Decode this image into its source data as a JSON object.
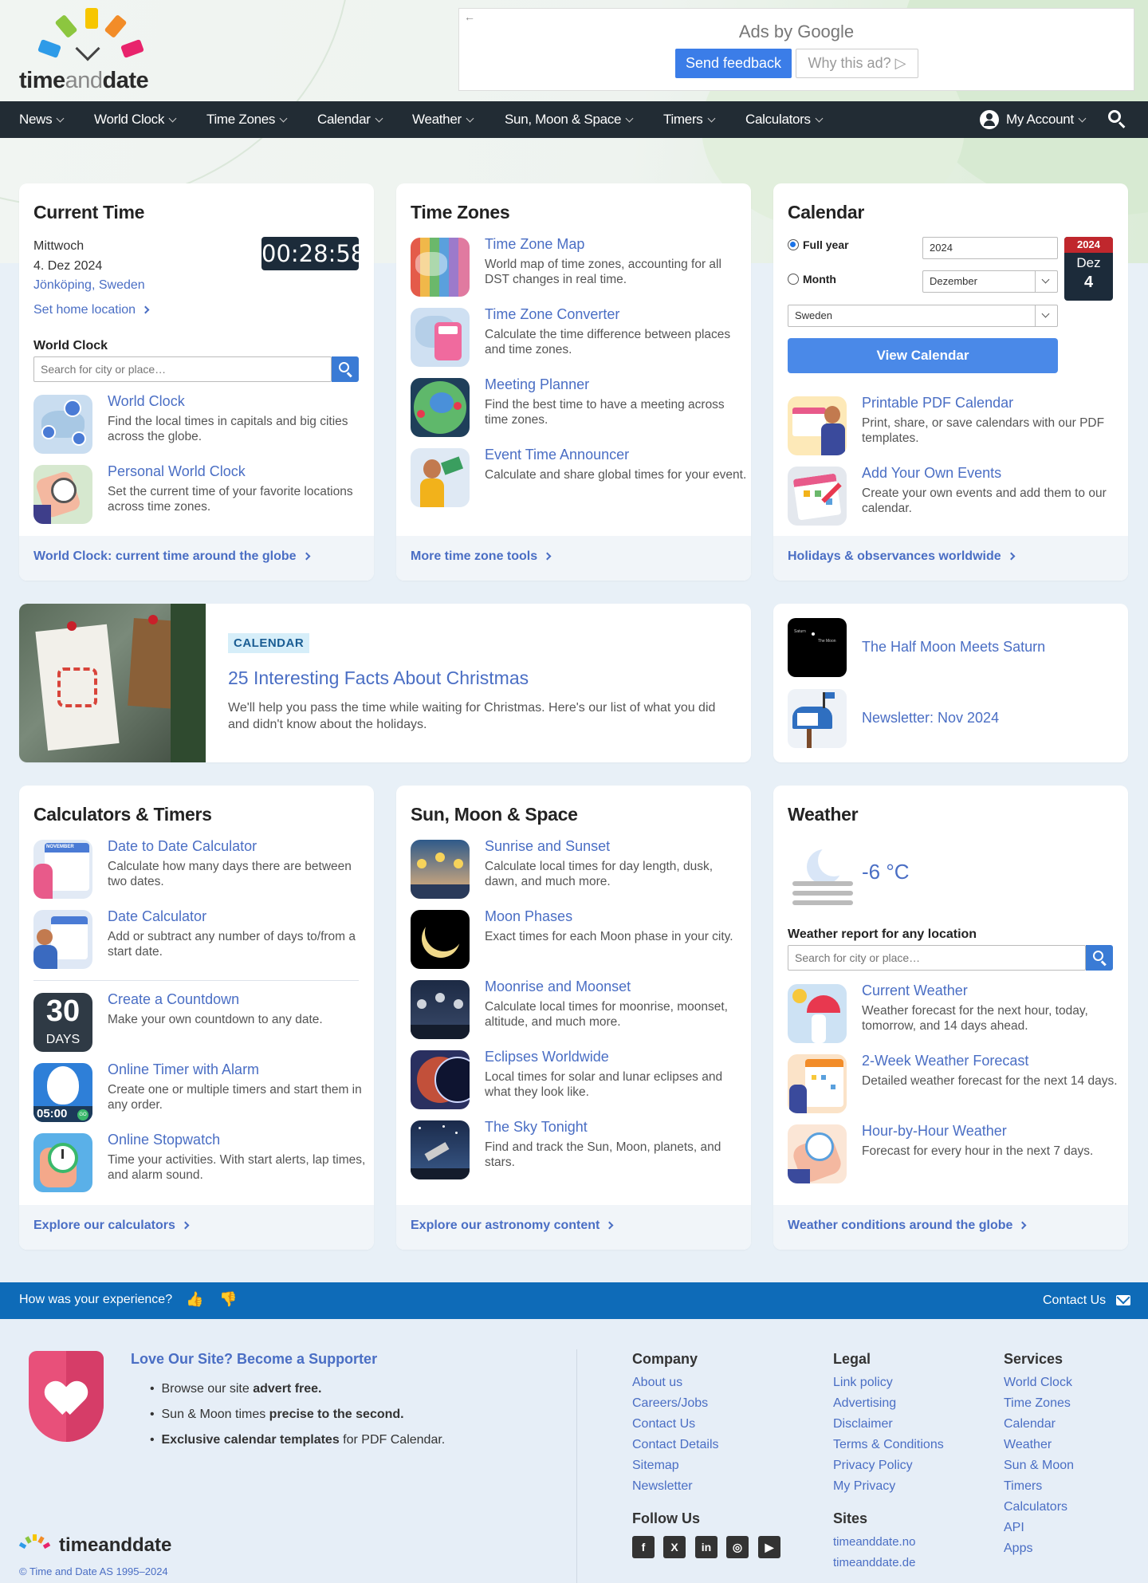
{
  "header": {
    "logo": "timeanddate",
    "ad": {
      "ads_by": "Ads by Google",
      "send_feedback": "Send feedback",
      "why_this_ad": "Why this ad?"
    }
  },
  "nav": {
    "items": [
      "News",
      "World Clock",
      "Time Zones",
      "Calendar",
      "Weather",
      "Sun, Moon & Space",
      "Timers",
      "Calculators"
    ],
    "account": "My Account"
  },
  "current_time": {
    "title": "Current Time",
    "weekday": "Mittwoch",
    "date": "4. Dez 2024",
    "location": "Jönköping, Sweden",
    "clock": "00:28:58",
    "set_home": "Set home location",
    "world_clock_label": "World Clock",
    "search_placeholder": "Search for city or place…",
    "tools": [
      {
        "title": "World Clock",
        "desc": "Find the local times in capitals and big cities across the globe."
      },
      {
        "title": "Personal World Clock",
        "desc": "Set the current time of your favorite locations across time zones."
      }
    ],
    "footer_link": "World Clock: current time around the globe"
  },
  "time_zones": {
    "title": "Time Zones",
    "tools": [
      {
        "title": "Time Zone Map",
        "desc": "World map of time zones, accounting for all DST changes in real time."
      },
      {
        "title": "Time Zone Converter",
        "desc": "Calculate the time difference between places and time zones."
      },
      {
        "title": "Meeting Planner",
        "desc": "Find the best time to have a meeting across time zones."
      },
      {
        "title": "Event Time Announcer",
        "desc": "Calculate and share global times for your event."
      }
    ],
    "footer_link": "More time zone tools"
  },
  "calendar": {
    "title": "Calendar",
    "full_year_label": "Full year",
    "month_label": "Month",
    "year_value": "2024",
    "month_value": "Dezember",
    "country_value": "Sweden",
    "view_button": "View Calendar",
    "badge": {
      "year": "2024",
      "month": "Dez",
      "day": "4"
    },
    "tools": [
      {
        "title": "Printable PDF Calendar",
        "desc": "Print, share, or save calendars with our PDF templates."
      },
      {
        "title": "Add Your Own Events",
        "desc": "Create your own events and add them to our calendar."
      }
    ],
    "footer_link": "Holidays & observances worldwide"
  },
  "feature": {
    "tag": "CALENDAR",
    "title": "25 Interesting Facts About Christmas",
    "desc": "We'll help you pass the time while waiting for Christmas. Here's our list of what you did and didn't know about the holidays."
  },
  "news": {
    "items": [
      {
        "title": "The Half Moon Meets Saturn",
        "thumb_label_1": "Saturn",
        "thumb_label_2": "The Moon"
      },
      {
        "title": "Newsletter: Nov 2024"
      }
    ]
  },
  "calculators": {
    "title": "Calculators & Timers",
    "tools": [
      {
        "title": "Date to Date Calculator",
        "desc": "Calculate how many days there are between two dates."
      },
      {
        "title": "Date Calculator",
        "desc": "Add or subtract any number of days to/from a start date."
      },
      {
        "title": "Create a Countdown",
        "desc": "Make your own countdown to any date."
      },
      {
        "title": "Online Timer with Alarm",
        "desc": "Create one or multiple timers and start them in any order."
      },
      {
        "title": "Online Stopwatch",
        "desc": "Time your activities. With start alerts, lap times, and alarm sound."
      }
    ],
    "countdown_icon": {
      "number": "30",
      "unit": "DAYS"
    },
    "timer_icon": {
      "time": "05:00",
      "go": "GO"
    },
    "calendar_icon_label": "NOVEMBER",
    "footer_link": "Explore our calculators"
  },
  "astronomy": {
    "title": "Sun, Moon & Space",
    "tools": [
      {
        "title": "Sunrise and Sunset",
        "desc": "Calculate local times for day length, dusk, dawn, and much more."
      },
      {
        "title": "Moon Phases",
        "desc": "Exact times for each Moon phase in your city."
      },
      {
        "title": "Moonrise and Moonset",
        "desc": "Calculate local times for moonrise, moonset, altitude, and much more."
      },
      {
        "title": "Eclipses Worldwide",
        "desc": "Local times for solar and lunar eclipses and what they look like."
      },
      {
        "title": "The Sky Tonight",
        "desc": "Find and track the Sun, Moon, planets, and stars."
      }
    ],
    "footer_link": "Explore our astronomy content"
  },
  "weather": {
    "title": "Weather",
    "temperature": "-6 °C",
    "report_label": "Weather report for any location",
    "search_placeholder": "Search for city or place…",
    "tools": [
      {
        "title": "Current Weather",
        "desc": "Weather forecast for the next hour, today, tomorrow, and 14 days ahead."
      },
      {
        "title": "2-Week Weather Forecast",
        "desc": "Detailed weather forecast for the next 14 days."
      },
      {
        "title": "Hour-by-Hour Weather",
        "desc": "Forecast for every hour in the next 7 days."
      }
    ],
    "footer_link": "Weather conditions around the globe"
  },
  "feedback_bar": {
    "question": "How was your experience?",
    "contact": "Contact Us"
  },
  "footer": {
    "supporter": {
      "title": "Love Our Site? Become a Supporter",
      "bullets": [
        {
          "pre": "Browse our site ",
          "bold": "advert free.",
          "post": ""
        },
        {
          "pre": "Sun & Moon times ",
          "bold": "precise to the second.",
          "post": ""
        },
        {
          "pre": "",
          "bold": "Exclusive calendar templates",
          "post": " for PDF Calendar."
        }
      ]
    },
    "logo": "timeanddate",
    "copyright": "© Time and Date AS 1995–2024",
    "company": {
      "title": "Company",
      "links": [
        "About us",
        "Careers/Jobs",
        "Contact Us",
        "Contact Details",
        "Sitemap",
        "Newsletter"
      ]
    },
    "legal": {
      "title": "Legal",
      "links": [
        "Link policy",
        "Advertising",
        "Disclaimer",
        "Terms & Conditions",
        "Privacy Policy",
        "My Privacy"
      ]
    },
    "services": {
      "title": "Services",
      "links": [
        "World Clock",
        "Time Zones",
        "Calendar",
        "Weather",
        "Sun & Moon",
        "Timers",
        "Calculators",
        "API",
        "Apps"
      ]
    },
    "follow": {
      "title": "Follow Us",
      "networks": [
        "facebook-icon",
        "x-icon",
        "linkedin-icon",
        "instagram-icon",
        "youtube-icon"
      ]
    },
    "sites": {
      "title": "Sites",
      "links": [
        "timeanddate.no",
        "timeanddate.de"
      ]
    }
  },
  "colors": {
    "accent": "#4a6ec4",
    "nav": "#222c34",
    "footer_bar": "#0e6bb8",
    "clock_bg": "#1c2b3a",
    "button": "#4a89e8"
  }
}
